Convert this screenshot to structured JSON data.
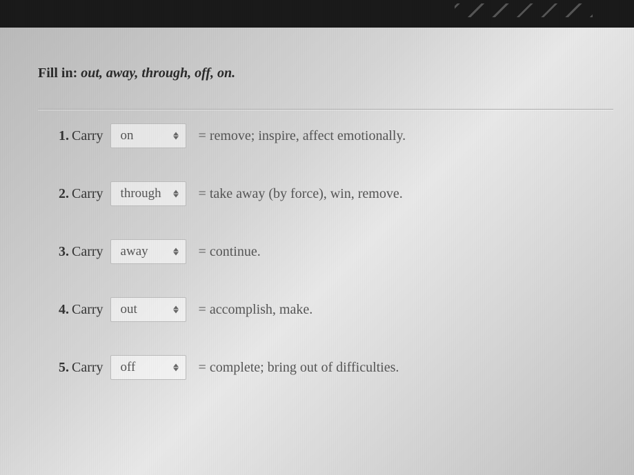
{
  "instruction": {
    "prefix": "Fill in: ",
    "words": "out, away, through, off, on.",
    "options": [
      "out",
      "away",
      "through",
      "off",
      "on"
    ]
  },
  "items": [
    {
      "number": "1.",
      "label": "Carry",
      "selected": "on",
      "definition": "= remove; inspire, affect emotionally."
    },
    {
      "number": "2.",
      "label": "Carry",
      "selected": "through",
      "definition": "= take away (by force), win, remove."
    },
    {
      "number": "3.",
      "label": "Carry",
      "selected": "away",
      "definition": "= continue."
    },
    {
      "number": "4.",
      "label": "Carry",
      "selected": "out",
      "definition": "= accomplish, make."
    },
    {
      "number": "5.",
      "label": "Carry",
      "selected": "off",
      "definition": "= complete; bring out of difficulties."
    }
  ]
}
